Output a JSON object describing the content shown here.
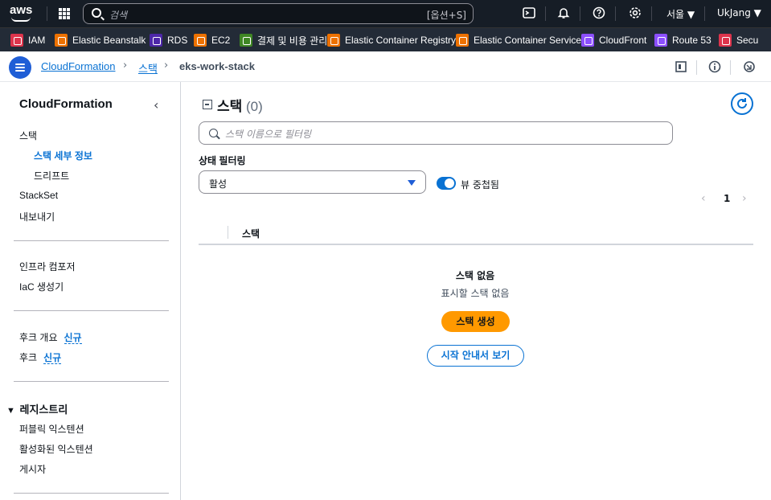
{
  "topnav": {
    "logo": "aws",
    "search_placeholder": "검색",
    "search_shortcut": "[옵션+S]",
    "region": "서울 ▼",
    "user": "UkJang ▼"
  },
  "favorites": [
    {
      "label": "IAM",
      "color": "#dd344c"
    },
    {
      "label": "Elastic Beanstalk",
      "color": "#ed7100"
    },
    {
      "label": "RDS",
      "color": "#4d27a8"
    },
    {
      "label": "EC2",
      "color": "#ed7100"
    },
    {
      "label": "결제 및 비용 관리",
      "color": "#3f8624"
    },
    {
      "label": "Elastic Container Registry",
      "color": "#ed7100"
    },
    {
      "label": "Elastic Container Service",
      "color": "#ed7100"
    },
    {
      "label": "CloudFront",
      "color": "#8c4fff"
    },
    {
      "label": "Route 53",
      "color": "#8c4fff"
    },
    {
      "label": "Secu",
      "color": "#dd344c"
    }
  ],
  "breadcrumb": {
    "items": [
      "CloudFormation",
      "스택",
      "eks-work-stack"
    ]
  },
  "sidebar": {
    "title": "CloudFormation",
    "group1": [
      "스택",
      "스택 세부 정보",
      "드리프트",
      "StackSet",
      "내보내기"
    ],
    "group2": [
      "인프라 컴포저",
      "IaC 생성기"
    ],
    "group3": [
      {
        "label": "후크 개요",
        "badge": "신규"
      },
      {
        "label": "후크",
        "badge": "신규"
      }
    ],
    "registry_title": "레지스트리",
    "registry_items": [
      "퍼블릭 익스텐션",
      "활성화된 익스텐션",
      "게시자"
    ]
  },
  "main": {
    "title": "스택",
    "count": "(0)",
    "filter_placeholder": "스택 이름으로 필터링",
    "status_label": "상태 필터링",
    "status_value": "활성",
    "nested_toggle_label": "뷰 중첩됨",
    "page_number": "1",
    "column_header": "스택",
    "empty_title": "스택 없음",
    "empty_sub": "표시할 스택 없음",
    "create_button": "스택 생성",
    "guide_button": "시작 안내서 보기"
  }
}
